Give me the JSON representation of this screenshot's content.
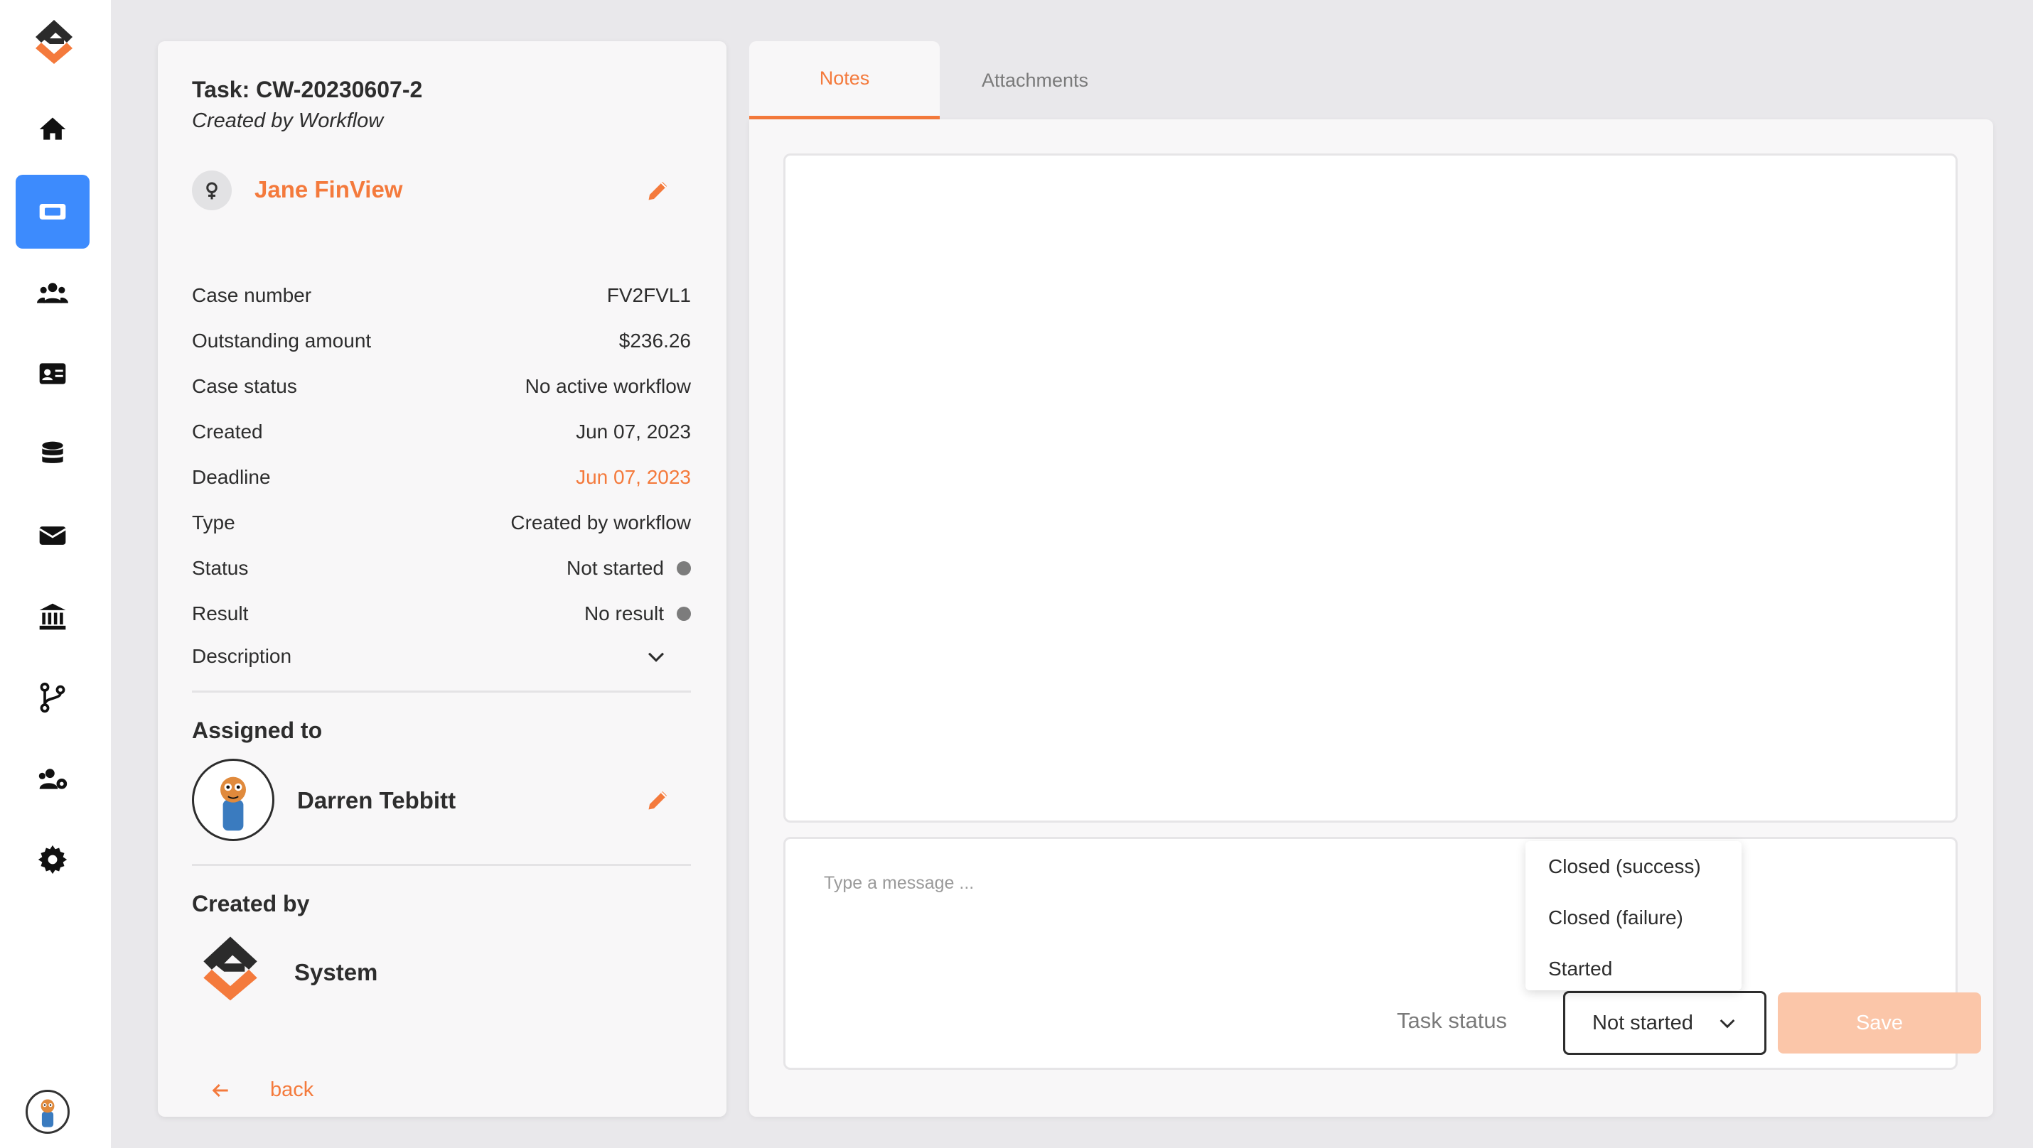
{
  "task": {
    "title": "Task: CW-20230607-2",
    "subtitle": "Created by Workflow",
    "client_name": "Jane FinView",
    "gender_icon": "female-icon"
  },
  "details": [
    {
      "label": "Case number",
      "value": "FV2FVL1"
    },
    {
      "label": "Outstanding amount",
      "value": "$236.26"
    },
    {
      "label": "Case status",
      "value": "No active workflow"
    },
    {
      "label": "Created",
      "value": "Jun 07, 2023"
    },
    {
      "label": "Deadline",
      "value": "Jun 07, 2023",
      "color": "#f47a3c"
    },
    {
      "label": "Type",
      "value": "Created by workflow"
    },
    {
      "label": "Status",
      "value": "Not started",
      "dot_color": "#7c7c7c"
    },
    {
      "label": "Result",
      "value": "No result",
      "dot_color": "#7c7c7c"
    },
    {
      "label": "Description",
      "value": ""
    }
  ],
  "assigned": {
    "title": "Assigned to",
    "name": "Darren Tebbitt"
  },
  "created_by": {
    "title": "Created by",
    "name": "System"
  },
  "back": {
    "label": "back"
  },
  "tabs": [
    {
      "label": "Notes",
      "active": true
    },
    {
      "label": "Attachments",
      "active": false
    }
  ],
  "composer": {
    "placeholder": "Type a message ...",
    "task_status_label": "Task status",
    "selected_status": "Not started",
    "save_label": "Save"
  },
  "status_options": [
    "Closed (success)",
    "Closed (failure)",
    "Started"
  ],
  "colors": {
    "accent": "#f47a3c",
    "nav_active": "#3d8bfd",
    "save_disabled": "#fbc6a9"
  }
}
